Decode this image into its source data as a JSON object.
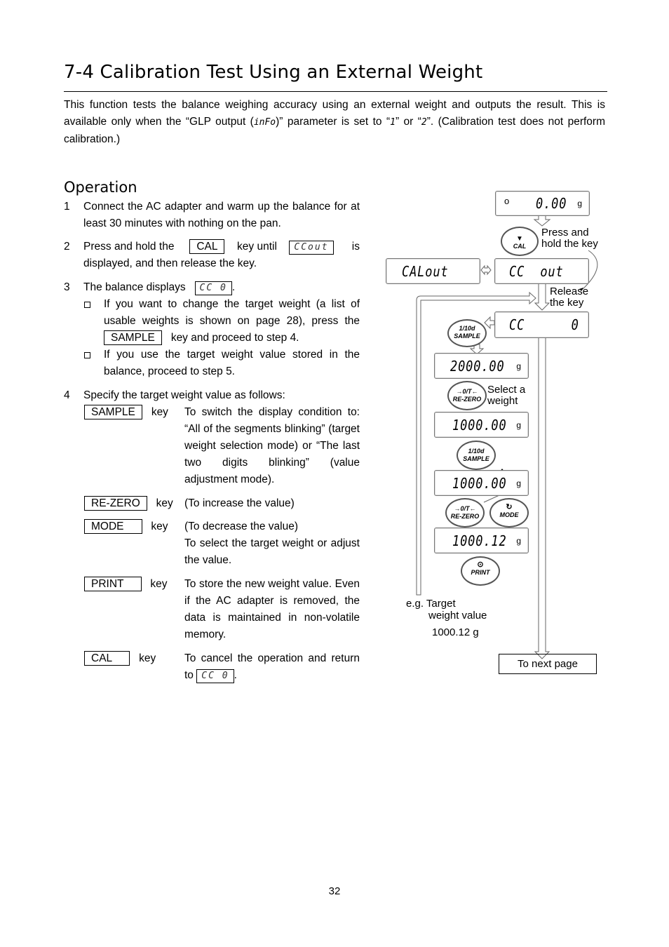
{
  "title": "7-4  Calibration Test Using an External Weight",
  "intro": {
    "part1": "This function tests the balance weighing accuracy using an external weight and outputs the result. This is available only when the “GLP output (",
    "param": "inFo",
    "part2": ")” parameter is set to “",
    "val1": "1",
    "part3": "” or “",
    "val2": "2",
    "part4": "”. (Calibration test does not perform calibration.)"
  },
  "operation": {
    "heading": "Operation",
    "steps": [
      {
        "num": "1",
        "text": "Connect the AC adapter and warm up the balance for at least 30 minutes with nothing on the pan."
      },
      {
        "num": "2",
        "pre": "Press and hold the",
        "key": "CAL",
        "mid": "key until",
        "display": "CCout",
        "post": "is displayed, and then release the key."
      },
      {
        "num": "3",
        "pre": "The balance displays",
        "display": "CC   0",
        "post": ".",
        "bullets": [
          {
            "pre": "If you want to change the target weight (a list of usable weights is shown on page 28), press the",
            "key": "SAMPLE",
            "post": "key and proceed to step 4."
          },
          {
            "text": "If you use the target weight value stored in the balance, proceed to step 5."
          }
        ]
      },
      {
        "num": "4",
        "text": "Specify the target weight value as follows:",
        "keys": [
          {
            "key": "SAMPLE",
            "word": "key",
            "desc": "To switch the display condition to: “All of the segments blinking” (target weight selection mode) or “The last two digits blinking” (value adjustment mode)."
          },
          {
            "key": "RE-ZERO",
            "word": "key",
            "desc": "(To increase the value)"
          },
          {
            "key": "MODE",
            "word": "key",
            "desc": "(To decrease the value)",
            "desc2": "To select the target weight or adjust the value."
          },
          {
            "key": "PRINT",
            "word": "key",
            "desc": "To store the new weight value. Even if the AC adapter is removed, the data is maintained in non-volatile memory."
          },
          {
            "key": "CAL",
            "word": "key",
            "desc": "To cancel the operation and return to",
            "display": "CC   0",
            "post": "."
          }
        ]
      }
    ]
  },
  "diagram": {
    "displays": {
      "zero": "0.00",
      "zero_unit": "g",
      "calout": "CALout",
      "ccout": "CC  out",
      "cc0": "CC      0",
      "w2000": "2000.00",
      "w1000a": "1000.00",
      "w1000b": "1000.00",
      "w1000c": "1000.12",
      "unit": "g",
      "stable": "o"
    },
    "keys": {
      "cal": "CAL",
      "sample_top": "1/10d",
      "sample": "SAMPLE",
      "rezero_top": "→0/T←",
      "rezero": "RE-ZERO",
      "mode_top": "↻",
      "mode": "MODE",
      "print_top": "⊙",
      "print": "PRINT"
    },
    "labels": {
      "press": "Press and hold the key",
      "release": "Release the key",
      "select": "Select a weight",
      "eg": "e.g. Target",
      "eg2": "weight value",
      "eg_value": "1000.12 g",
      "next": "To next page"
    }
  },
  "page_number": "32"
}
